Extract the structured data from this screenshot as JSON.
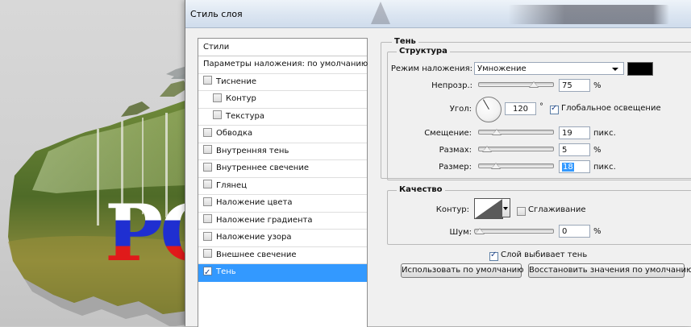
{
  "dialog": {
    "title": "Стиль слоя"
  },
  "canvas_text": {
    "letters": "РО"
  },
  "styles_list": {
    "header": "Стили",
    "items": [
      {
        "label": "Параметры наложения: по умолчанию",
        "has_checkbox": false,
        "checked": false,
        "indent": false,
        "selected": false
      },
      {
        "label": "Тиснение",
        "has_checkbox": true,
        "checked": false,
        "indent": false,
        "selected": false
      },
      {
        "label": "Контур",
        "has_checkbox": true,
        "checked": false,
        "indent": true,
        "selected": false
      },
      {
        "label": "Текстура",
        "has_checkbox": true,
        "checked": false,
        "indent": true,
        "selected": false
      },
      {
        "label": "Обводка",
        "has_checkbox": true,
        "checked": false,
        "indent": false,
        "selected": false
      },
      {
        "label": "Внутренняя тень",
        "has_checkbox": true,
        "checked": false,
        "indent": false,
        "selected": false
      },
      {
        "label": "Внутреннее свечение",
        "has_checkbox": true,
        "checked": false,
        "indent": false,
        "selected": false
      },
      {
        "label": "Глянец",
        "has_checkbox": true,
        "checked": false,
        "indent": false,
        "selected": false
      },
      {
        "label": "Наложение цвета",
        "has_checkbox": true,
        "checked": false,
        "indent": false,
        "selected": false
      },
      {
        "label": "Наложение градиента",
        "has_checkbox": true,
        "checked": false,
        "indent": false,
        "selected": false
      },
      {
        "label": "Наложение узора",
        "has_checkbox": true,
        "checked": false,
        "indent": false,
        "selected": false
      },
      {
        "label": "Внешнее свечение",
        "has_checkbox": true,
        "checked": false,
        "indent": false,
        "selected": false
      },
      {
        "label": "Тень",
        "has_checkbox": true,
        "checked": true,
        "indent": false,
        "selected": true
      }
    ]
  },
  "shadow": {
    "group_title": "Тень",
    "structure": {
      "title": "Структура",
      "blend_mode_label": "Режим наложения:",
      "blend_mode_value": "Умножение",
      "shadow_color": "#000000",
      "opacity_label": "Непрозр.:",
      "opacity_value": "75",
      "opacity_unit": "%",
      "opacity_fraction": 0.75,
      "angle_label": "Угол:",
      "angle_value": "120",
      "angle_unit": "°",
      "angle_degrees": 120,
      "global_light_label": "Глобальное освещение",
      "global_light_checked": true,
      "distance_label": "Смещение:",
      "distance_value": "19",
      "distance_unit": "пикс.",
      "distance_fraction": 0.19,
      "spread_label": "Размах:",
      "spread_value": "5",
      "spread_unit": "%",
      "spread_fraction": 0.05,
      "size_label": "Размер:",
      "size_value": "18",
      "size_unit": "пикс.",
      "size_fraction": 0.18
    },
    "quality": {
      "title": "Качество",
      "contour_label": "Контур:",
      "antialias_label": "Сглаживание",
      "antialias_checked": false,
      "noise_label": "Шум:",
      "noise_value": "0",
      "noise_unit": "%",
      "noise_fraction": 0.0
    },
    "knockout_label": "Слой выбивает тень",
    "knockout_checked": true,
    "make_default_label": "Использовать по умолчанию",
    "reset_default_label": "Восстановить значения по умолчанию"
  },
  "colors": {
    "selection": "#3399ff",
    "dialog_bg": "#f0f0f0",
    "flag_white": "#ffffff",
    "flag_blue": "#1f2fd1",
    "flag_red": "#e01a1a"
  }
}
